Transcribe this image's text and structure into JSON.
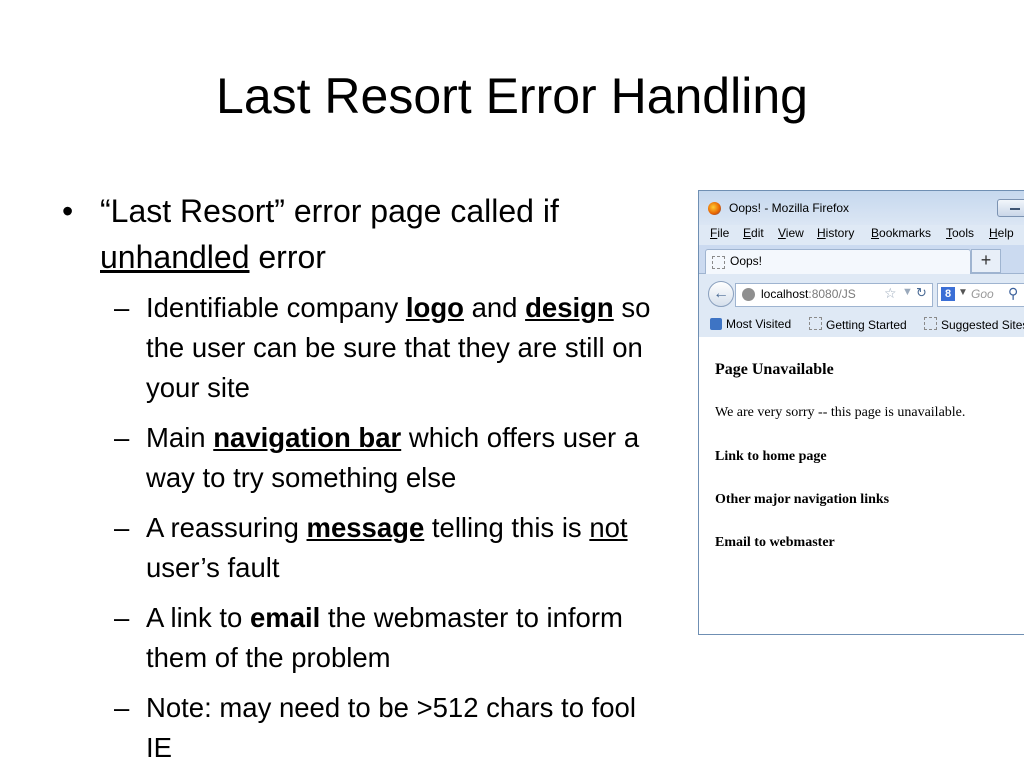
{
  "title": "Last Resort Error Handling",
  "bullet": {
    "pre": "“Last Resort” error page called if ",
    "underlined": "unhandled",
    "post": " error"
  },
  "sub_bullets": [
    {
      "a": "Identifiable company ",
      "b": "logo",
      "c": " and ",
      "d": "design",
      "e": " so the user can be sure that they are still on your site"
    },
    {
      "a": "Main ",
      "b": "navigation bar",
      "c": " which offers user a way to try something else"
    },
    {
      "a": "A reassuring ",
      "b": "message",
      "c": " telling this is ",
      "d": "not",
      "e": " user’s fault"
    },
    {
      "a": "A link to ",
      "b": "email",
      "c": " the webmaster to inform them of the problem"
    },
    {
      "a": "Note: may need to be >512 chars to fool IE"
    }
  ],
  "browser": {
    "window_title": "Oops! - Mozilla Firefox",
    "menu": [
      "File",
      "Edit",
      "View",
      "History",
      "Bookmarks",
      "Tools",
      "Help"
    ],
    "tab_title": "Oops!",
    "new_tab": "+",
    "url_host": "localhost",
    "url_rest": ":8080/JS",
    "search_placeholder": "Goo",
    "search_engine": "8",
    "bookmarks": [
      "Most Visited",
      "Getting Started",
      "Suggested Sites"
    ],
    "page_heading": "Page Unavailable",
    "page_message": "We are very sorry -- this page is unavailable.",
    "links": [
      "Link to home page",
      "Other major navigation links",
      "Email to webmaster"
    ]
  }
}
